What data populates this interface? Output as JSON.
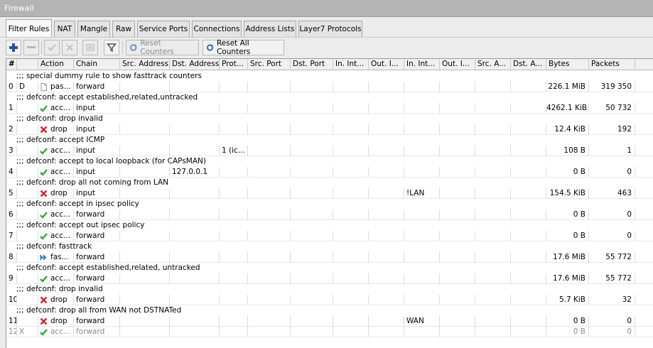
{
  "window": {
    "title": "Firewall"
  },
  "tabs": [
    {
      "label": "Filter Rules",
      "active": true
    },
    {
      "label": "NAT"
    },
    {
      "label": "Mangle"
    },
    {
      "label": "Raw"
    },
    {
      "label": "Service Ports"
    },
    {
      "label": "Connections"
    },
    {
      "label": "Address Lists"
    },
    {
      "label": "Layer7 Protocols"
    }
  ],
  "toolbar": {
    "add_icon": "plus-icon",
    "remove_icon": "minus-icon",
    "enable_icon": "check-icon",
    "disable_icon": "cross-icon",
    "comment_icon": "note-icon",
    "filter_icon": "funnel-icon",
    "reset_counters": "Reset Counters",
    "reset_all_counters": "Reset All Counters",
    "reset_icon": "reset-icon"
  },
  "columns": [
    "#",
    "",
    "Action",
    "Chain",
    "Src. Address",
    "Dst. Address",
    "Prot...",
    "Src. Port",
    "Dst. Port",
    "In. Int...",
    "Out. I...",
    "In. Int...",
    "Out. I...",
    "Src. A...",
    "Dst. A...",
    "Bytes",
    "Packets"
  ],
  "rows": [
    {
      "type": "comment",
      "text": ";;; special dummy rule to show fasttrack counters"
    },
    {
      "type": "rule",
      "num": "0",
      "flag": "D",
      "action": "pas...",
      "action_icon": "passthrough-icon",
      "chain": "forward",
      "src": "",
      "dst": "",
      "proto": "",
      "in_if_list": "",
      "bytes": "226.1 MiB",
      "packets": "319 350"
    },
    {
      "type": "comment",
      "text": ";;; defconf: accept established,related,untracked"
    },
    {
      "type": "rule",
      "num": "1",
      "flag": "",
      "action": "acc...",
      "action_icon": "accept-icon",
      "chain": "input",
      "src": "",
      "dst": "",
      "proto": "",
      "in_if_list": "",
      "bytes": "4262.1 KiB",
      "packets": "50 732"
    },
    {
      "type": "comment",
      "text": ";;; defconf: drop invalid"
    },
    {
      "type": "rule",
      "num": "2",
      "flag": "",
      "action": "drop",
      "action_icon": "drop-icon",
      "chain": "input",
      "src": "",
      "dst": "",
      "proto": "",
      "in_if_list": "",
      "bytes": "12.4 KiB",
      "packets": "192"
    },
    {
      "type": "comment",
      "text": ";;; defconf: accept ICMP"
    },
    {
      "type": "rule",
      "num": "3",
      "flag": "",
      "action": "acc...",
      "action_icon": "accept-icon",
      "chain": "input",
      "src": "",
      "dst": "",
      "proto": "1 (ic...",
      "in_if_list": "",
      "bytes": "108 B",
      "packets": "1"
    },
    {
      "type": "comment",
      "text": ";;; defconf: accept to local loopback (for CAPsMAN)"
    },
    {
      "type": "rule",
      "num": "4",
      "flag": "",
      "action": "acc...",
      "action_icon": "accept-icon",
      "chain": "input",
      "src": "",
      "dst": "127.0.0.1",
      "proto": "",
      "in_if_list": "",
      "bytes": "0 B",
      "packets": "0"
    },
    {
      "type": "comment",
      "text": ";;; defconf: drop all not coming from LAN"
    },
    {
      "type": "rule",
      "num": "5",
      "flag": "",
      "action": "drop",
      "action_icon": "drop-icon",
      "chain": "input",
      "src": "",
      "dst": "",
      "proto": "",
      "in_if_list": "!LAN",
      "bytes": "154.5 KiB",
      "packets": "463"
    },
    {
      "type": "comment",
      "text": ";;; defconf: accept in ipsec policy"
    },
    {
      "type": "rule",
      "num": "6",
      "flag": "",
      "action": "acc...",
      "action_icon": "accept-icon",
      "chain": "forward",
      "src": "",
      "dst": "",
      "proto": "",
      "in_if_list": "",
      "bytes": "0 B",
      "packets": "0"
    },
    {
      "type": "comment",
      "text": ";;; defconf: accept out ipsec policy"
    },
    {
      "type": "rule",
      "num": "7",
      "flag": "",
      "action": "acc...",
      "action_icon": "accept-icon",
      "chain": "forward",
      "src": "",
      "dst": "",
      "proto": "",
      "in_if_list": "",
      "bytes": "0 B",
      "packets": "0"
    },
    {
      "type": "comment",
      "text": ";;; defconf: fasttrack"
    },
    {
      "type": "rule",
      "num": "8",
      "flag": "",
      "action": "fas...",
      "action_icon": "fasttrack-icon",
      "chain": "forward",
      "src": "",
      "dst": "",
      "proto": "",
      "in_if_list": "",
      "bytes": "17.6 MiB",
      "packets": "55 772"
    },
    {
      "type": "comment",
      "text": ";;; defconf: accept established,related, untracked"
    },
    {
      "type": "rule",
      "num": "9",
      "flag": "",
      "action": "acc...",
      "action_icon": "accept-icon",
      "chain": "forward",
      "src": "",
      "dst": "",
      "proto": "",
      "in_if_list": "",
      "bytes": "17.6 MiB",
      "packets": "55 772"
    },
    {
      "type": "comment",
      "text": ";;; defconf: drop invalid"
    },
    {
      "type": "rule",
      "num": "10",
      "flag": "",
      "action": "drop",
      "action_icon": "drop-icon",
      "chain": "forward",
      "src": "",
      "dst": "",
      "proto": "",
      "in_if_list": "",
      "bytes": "5.7 KiB",
      "packets": "32"
    },
    {
      "type": "comment",
      "text": ";;; defconf: drop all from WAN not DSTNATed"
    },
    {
      "type": "rule",
      "num": "11",
      "flag": "",
      "action": "drop",
      "action_icon": "drop-icon",
      "chain": "forward",
      "src": "",
      "dst": "",
      "proto": "",
      "in_if_list": "WAN",
      "bytes": "0 B",
      "packets": "0"
    },
    {
      "type": "rule",
      "num": "12",
      "flag": "X",
      "action": "acc...",
      "action_icon": "accept-icon",
      "chain": "forward",
      "src": "",
      "dst": "",
      "proto": "",
      "in_if_list": "",
      "bytes": "0 B",
      "packets": "0",
      "disabled": true
    }
  ]
}
